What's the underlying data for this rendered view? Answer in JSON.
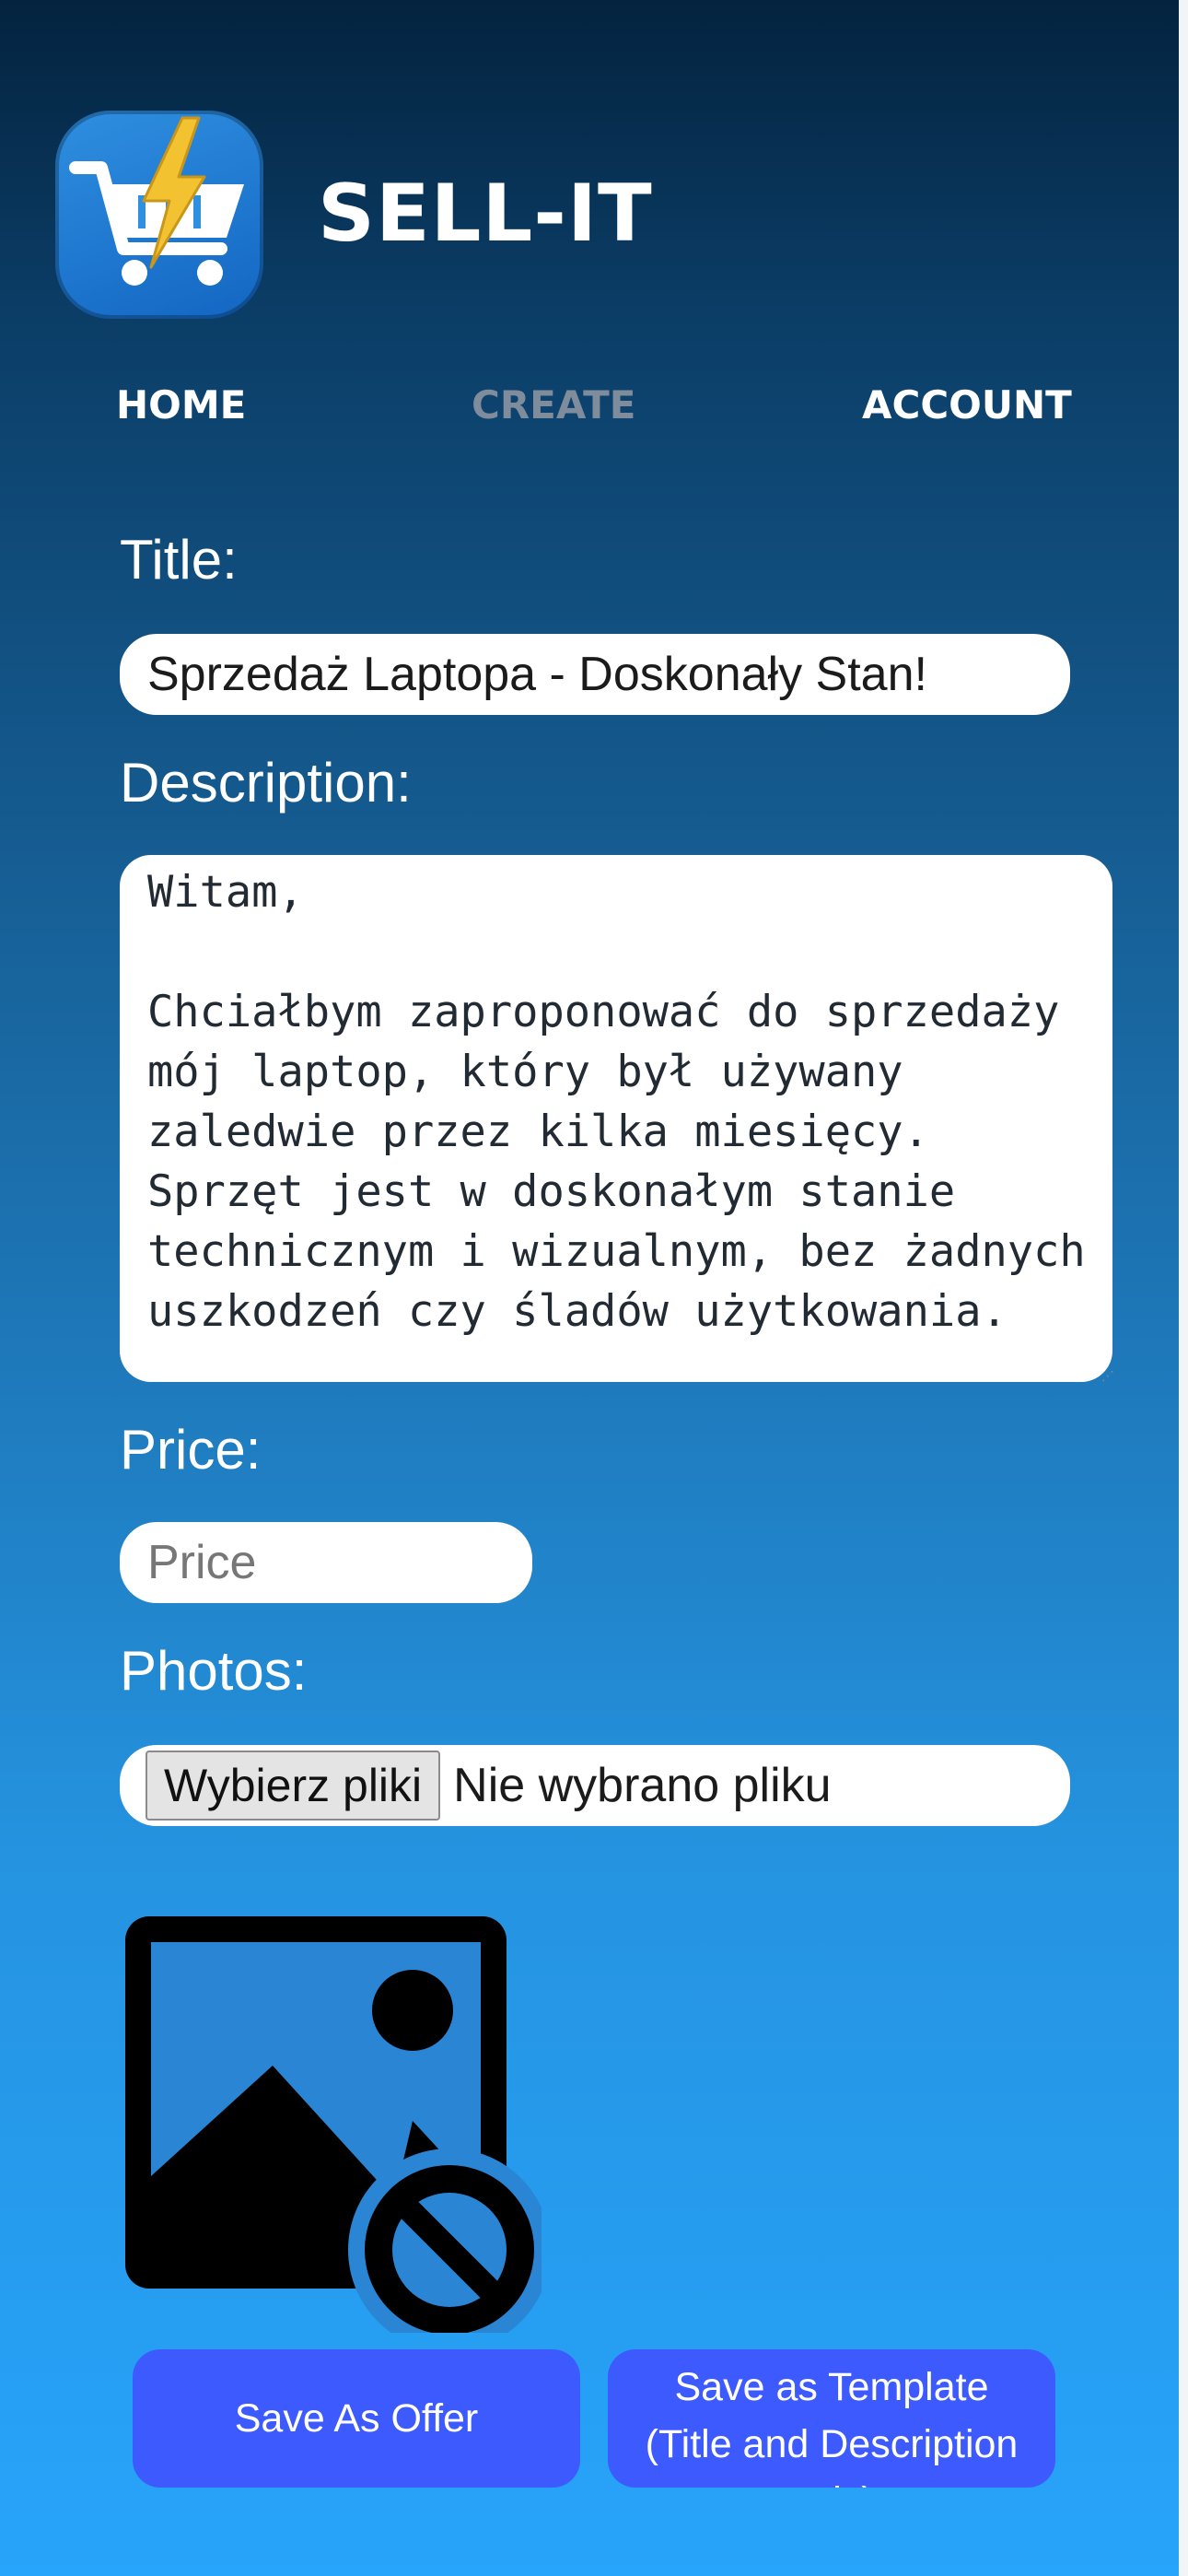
{
  "header": {
    "logo_icon": "cart-lightning-icon",
    "app_name": "SELL-IT"
  },
  "nav": {
    "home": "HOME",
    "create": "CREATE",
    "account": "ACCOUNT",
    "active": "CREATE"
  },
  "form": {
    "title_label": "Title:",
    "title_value": "Sprzedaż Laptopa - Doskonały Stan!",
    "description_label": "Description:",
    "description_value": "Witam,\n\nChciałbym zaproponować do sprzedaży mój laptop, który był używany zaledwie przez kilka miesięcy. Sprzęt jest w doskonałym stanie technicznym i wizualnym, bez żadnych uszkodzeń czy śladów użytkowania.",
    "price_label": "Price:",
    "price_placeholder": "Price",
    "price_value": "",
    "photos_label": "Photos:",
    "file_button": "Wybierz pliki",
    "file_status": "Nie wybrano pliku",
    "photo_icon": "image-unavailable-icon"
  },
  "actions": {
    "save_offer": "Save As Offer",
    "save_template": "Save as Template (Title and Description only)"
  },
  "colors": {
    "button": "#3d5afe",
    "nav_inactive": "#7f8c9c",
    "background_top": "#04233f",
    "background_bottom": "#27a4fb"
  }
}
